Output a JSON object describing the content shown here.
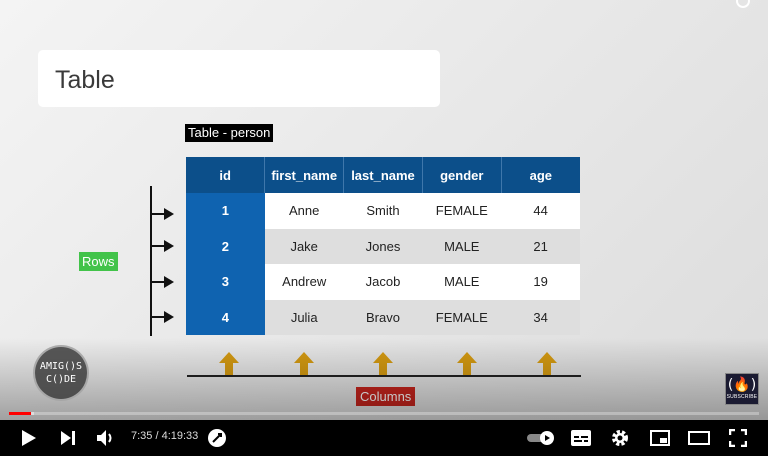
{
  "slide": {
    "title": "Table",
    "table_label": "Table - person",
    "rows_label": "Rows",
    "columns_label": "Columns"
  },
  "table": {
    "headers": [
      "id",
      "first_name",
      "last_name",
      "gender",
      "age"
    ],
    "rows": [
      [
        "1",
        "Anne",
        "Smith",
        "FEMALE",
        "44"
      ],
      [
        "2",
        "Jake",
        "Jones",
        "MALE",
        "21"
      ],
      [
        "3",
        "Andrew",
        "Jacob",
        "MALE",
        "19"
      ],
      [
        "4",
        "Julia",
        "Bravo",
        "FEMALE",
        "34"
      ]
    ]
  },
  "logos": {
    "amigos_line1": "AMIG()S",
    "amigos_line2": "C()DE",
    "fcc_subscribe": "SUBSCRIBE"
  },
  "player": {
    "time_display": "7:35 / 4:19:33",
    "progress_fraction": 0.029,
    "loaded_fraction": 0.033,
    "icons": [
      "play-icon",
      "next-icon",
      "volume-icon",
      "chapters-icon",
      "autoplay-toggle",
      "subtitles-icon",
      "settings-icon",
      "miniplayer-icon",
      "theater-icon",
      "fullscreen-icon"
    ]
  },
  "colors": {
    "header_blue": "#0c4f8a",
    "id_blue": "#0f63b0",
    "rows_green": "#42c34a",
    "columns_red": "#c8251e",
    "arrow_gold": "#d49a12",
    "progress_red": "#ff0000"
  }
}
